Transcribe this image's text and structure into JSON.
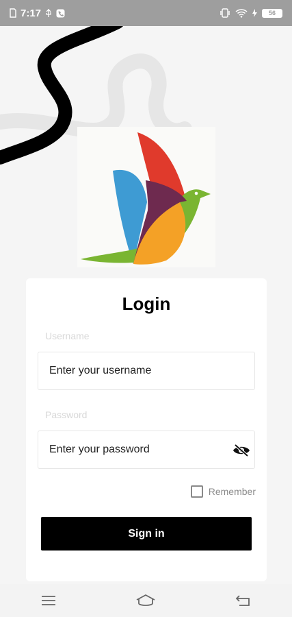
{
  "status_bar": {
    "time": "7:17",
    "battery_level": "56",
    "icons": [
      "sim-icon",
      "usb-icon",
      "phone-icon",
      "vibrate-icon",
      "wifi-icon",
      "battery-icon"
    ]
  },
  "login": {
    "title": "Login",
    "username_label": "Username",
    "username_placeholder": "Enter your username",
    "password_label": "Password",
    "password_placeholder": "Enter your password",
    "remember_label": "Remember",
    "sign_in_label": "Sign in"
  },
  "navigation": {
    "items": [
      "menu-icon",
      "home-icon",
      "back-icon"
    ]
  },
  "colors": {
    "status_bar": "#9e9e9e",
    "button": "#000000",
    "logo_red": "#e03a2c",
    "logo_blue": "#3e9bd3",
    "logo_green": "#7ab532",
    "logo_orange": "#f4a126",
    "logo_purple": "#6e2a4f"
  }
}
